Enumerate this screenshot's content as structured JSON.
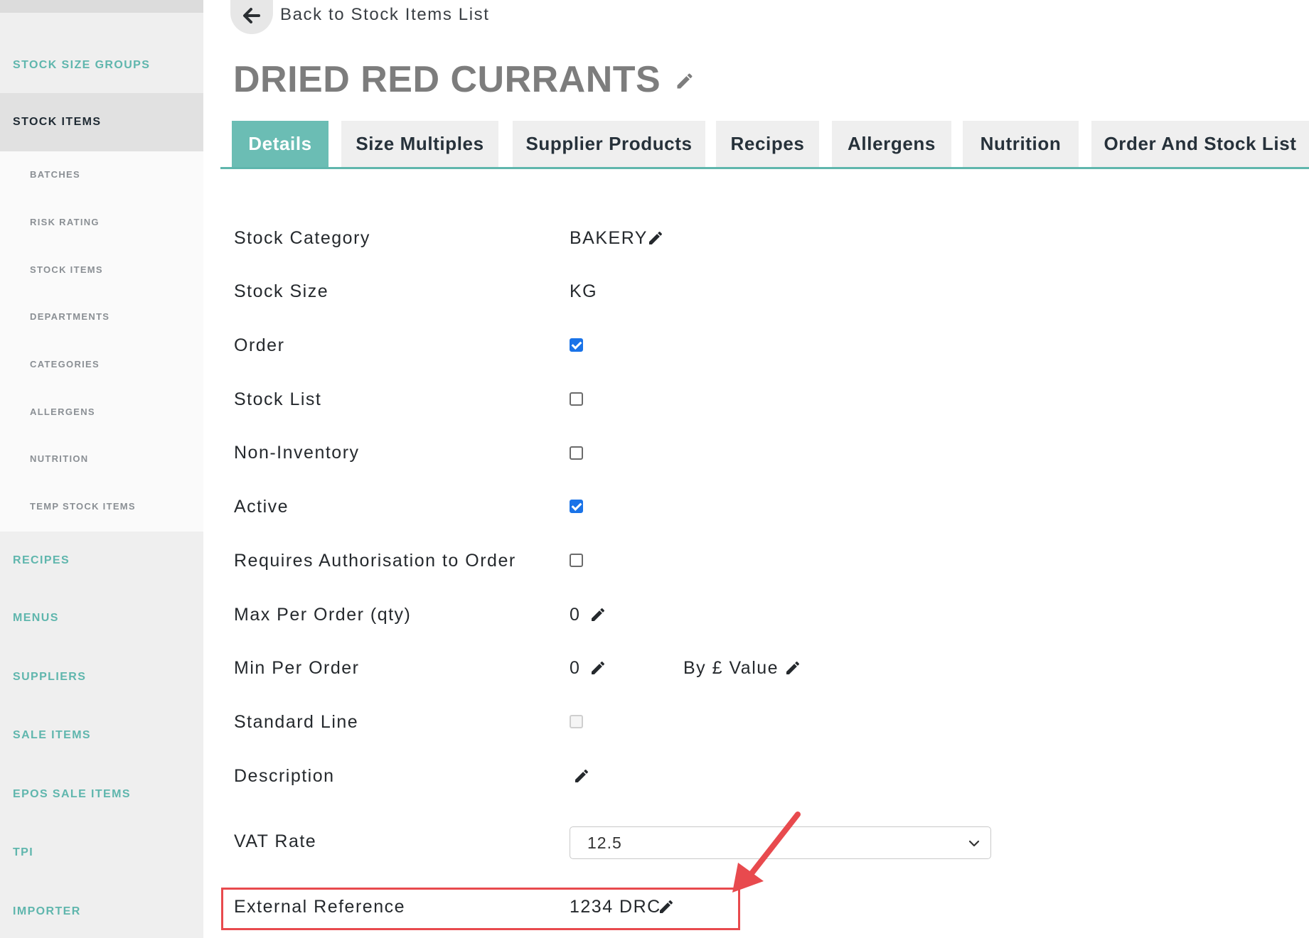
{
  "sidebar": {
    "main_items": [
      {
        "label": "STOCK SIZE GROUPS"
      },
      {
        "label": "STOCK ITEMS"
      },
      {
        "label": "RECIPES"
      },
      {
        "label": "MENUS"
      },
      {
        "label": "SUPPLIERS"
      },
      {
        "label": "SALE ITEMS"
      },
      {
        "label": "EPOS SALE ITEMS"
      },
      {
        "label": "TPI"
      },
      {
        "label": "IMPORTER"
      }
    ],
    "sub_items": [
      {
        "label": "BATCHES"
      },
      {
        "label": "RISK RATING"
      },
      {
        "label": "STOCK ITEMS"
      },
      {
        "label": "DEPARTMENTS"
      },
      {
        "label": "CATEGORIES"
      },
      {
        "label": "ALLERGENS"
      },
      {
        "label": "NUTRITION"
      },
      {
        "label": "TEMP STOCK ITEMS"
      }
    ]
  },
  "header": {
    "back_label": "Back to Stock Items List",
    "title": "DRIED RED CURRANTS"
  },
  "tabs": [
    {
      "label": "Details"
    },
    {
      "label": "Size Multiples"
    },
    {
      "label": "Supplier Products"
    },
    {
      "label": "Recipes"
    },
    {
      "label": "Allergens"
    },
    {
      "label": "Nutrition"
    },
    {
      "label": "Order And Stock List"
    }
  ],
  "fields": {
    "stock_category": {
      "label": "Stock Category",
      "value": "BAKERY"
    },
    "stock_size": {
      "label": "Stock Size",
      "value": "KG"
    },
    "order": {
      "label": "Order",
      "checked": true
    },
    "stock_list": {
      "label": "Stock List",
      "checked": false
    },
    "non_inventory": {
      "label": "Non-Inventory",
      "checked": false
    },
    "active": {
      "label": "Active",
      "checked": true
    },
    "requires_auth": {
      "label": "Requires Authorisation to Order",
      "checked": false
    },
    "max_per_order": {
      "label": "Max Per Order (qty)",
      "value": "0"
    },
    "min_per_order": {
      "label": "Min Per Order",
      "value": "0",
      "by_value_label": "By £ Value"
    },
    "standard_line": {
      "label": "Standard Line",
      "checked": false
    },
    "description": {
      "label": "Description",
      "value": ""
    },
    "vat_rate": {
      "label": "VAT Rate",
      "value": "12.5"
    },
    "external_reference": {
      "label": "External Reference",
      "value": "1234 DRC"
    }
  },
  "colors": {
    "accent": "#5fb6ad",
    "annotation": "#e84a4e",
    "checkbox_checked": "#1a73e8"
  }
}
